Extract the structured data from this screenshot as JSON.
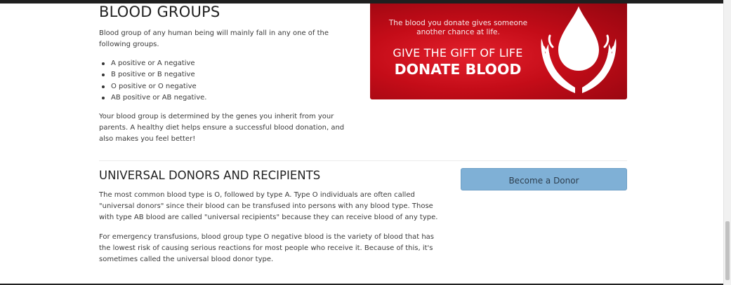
{
  "blood_groups": {
    "title": "BLOOD GROUPS",
    "intro": "Blood group of any human being will mainly fall in any one of the following groups.",
    "items": [
      "A positive or A negative",
      "B positive or B negative",
      "O positive or O negative",
      "AB positive or AB negative."
    ],
    "genes_text": "Your blood group is determined by the genes you inherit from your parents. A healthy diet helps ensure a successful blood donation, and also makes you feel better!"
  },
  "banner": {
    "tagline": "The blood you donate gives someone another chance at life.",
    "headline": "GIVE THE GIFT OF LIFE",
    "cta": "DONATE BLOOD",
    "icon": "blood-drop-hands-icon"
  },
  "universal": {
    "title": "UNIVERSAL DONORS AND RECIPIENTS",
    "paragraph1": "The most common blood type is O, followed by type A. Type O individuals are often called \"universal donors\" since their blood can be transfused into persons with any blood type. Those with type AB blood are called \"universal recipients\" because they can receive blood of any type.",
    "paragraph2": "For emergency transfusions, blood group type O negative blood is the variety of blood that has the lowest risk of causing serious reactions for most people who receive it. Because of this, it's sometimes called the universal blood donor type."
  },
  "donor_button": {
    "label": "Become a Donor"
  },
  "colors": {
    "banner_red": "#c40c18",
    "button_blue": "#7fb0d6"
  }
}
